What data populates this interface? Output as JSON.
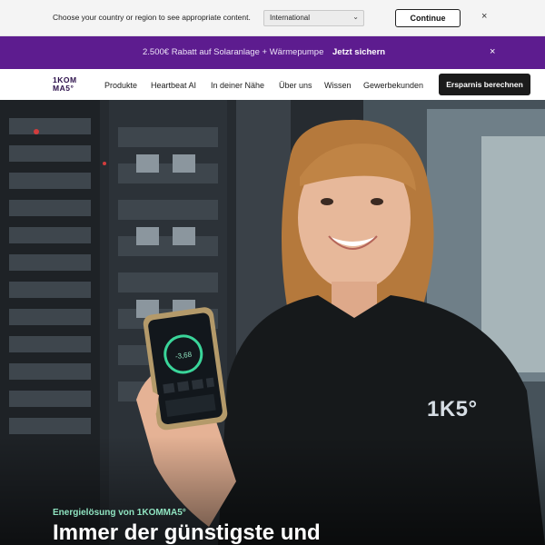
{
  "country_bar": {
    "text": "Choose your country or region to see appropriate content.",
    "selected_region": "International",
    "continue_label": "Continue",
    "close_glyph": "×"
  },
  "promo_bar": {
    "text": "2.500€ Rabatt auf Solaranlage + Wärmepumpe",
    "link": "Jetzt sichern",
    "close_glyph": "×",
    "color": "#5d1c8f"
  },
  "nav": {
    "logo_line1": "1KOM",
    "logo_line2": "MA5°",
    "items": [
      "Produkte",
      "Heartbeat AI",
      "In deiner Nähe",
      "Über uns",
      "Wissen",
      "Gewerbekunden"
    ],
    "cta": "Ersparnis berechnen"
  },
  "hero": {
    "eyebrow": "Energielösung von 1KOMMA5°",
    "title": "Immer der günstigste und",
    "shirt_logo": "1K5°",
    "eyebrow_color": "#8fe3c0"
  }
}
